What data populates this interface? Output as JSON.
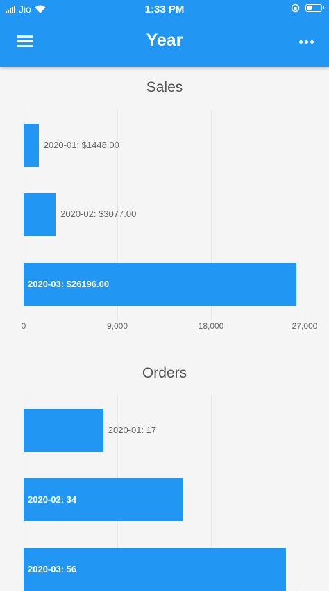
{
  "status_bar": {
    "carrier": "Jio",
    "time": "1:33 PM"
  },
  "app_bar": {
    "title": "Year"
  },
  "chart_data": [
    {
      "type": "bar",
      "orientation": "horizontal",
      "title": "Sales",
      "categories": [
        "2020-01",
        "2020-02",
        "2020-03"
      ],
      "values": [
        1448.0,
        3077.0,
        26196.0
      ],
      "labels": [
        "2020-01: $1448.00",
        "2020-02: $3077.00",
        "2020-03: $26196.00"
      ],
      "xlim": [
        0,
        27000
      ],
      "ticks": [
        "0",
        "9,000",
        "18,000",
        "27,000"
      ],
      "tick_values": [
        0,
        9000,
        18000,
        27000
      ],
      "color": "#2196f3"
    },
    {
      "type": "bar",
      "orientation": "horizontal",
      "title": "Orders",
      "categories": [
        "2020-01",
        "2020-02",
        "2020-03"
      ],
      "values": [
        17,
        34,
        56
      ],
      "labels": [
        "2020-01: 17",
        "2020-02: 34",
        "2020-03: 56"
      ],
      "xlim": [
        0,
        60
      ],
      "tick_values": [
        0,
        20,
        40,
        60
      ],
      "color": "#2196f3"
    }
  ]
}
